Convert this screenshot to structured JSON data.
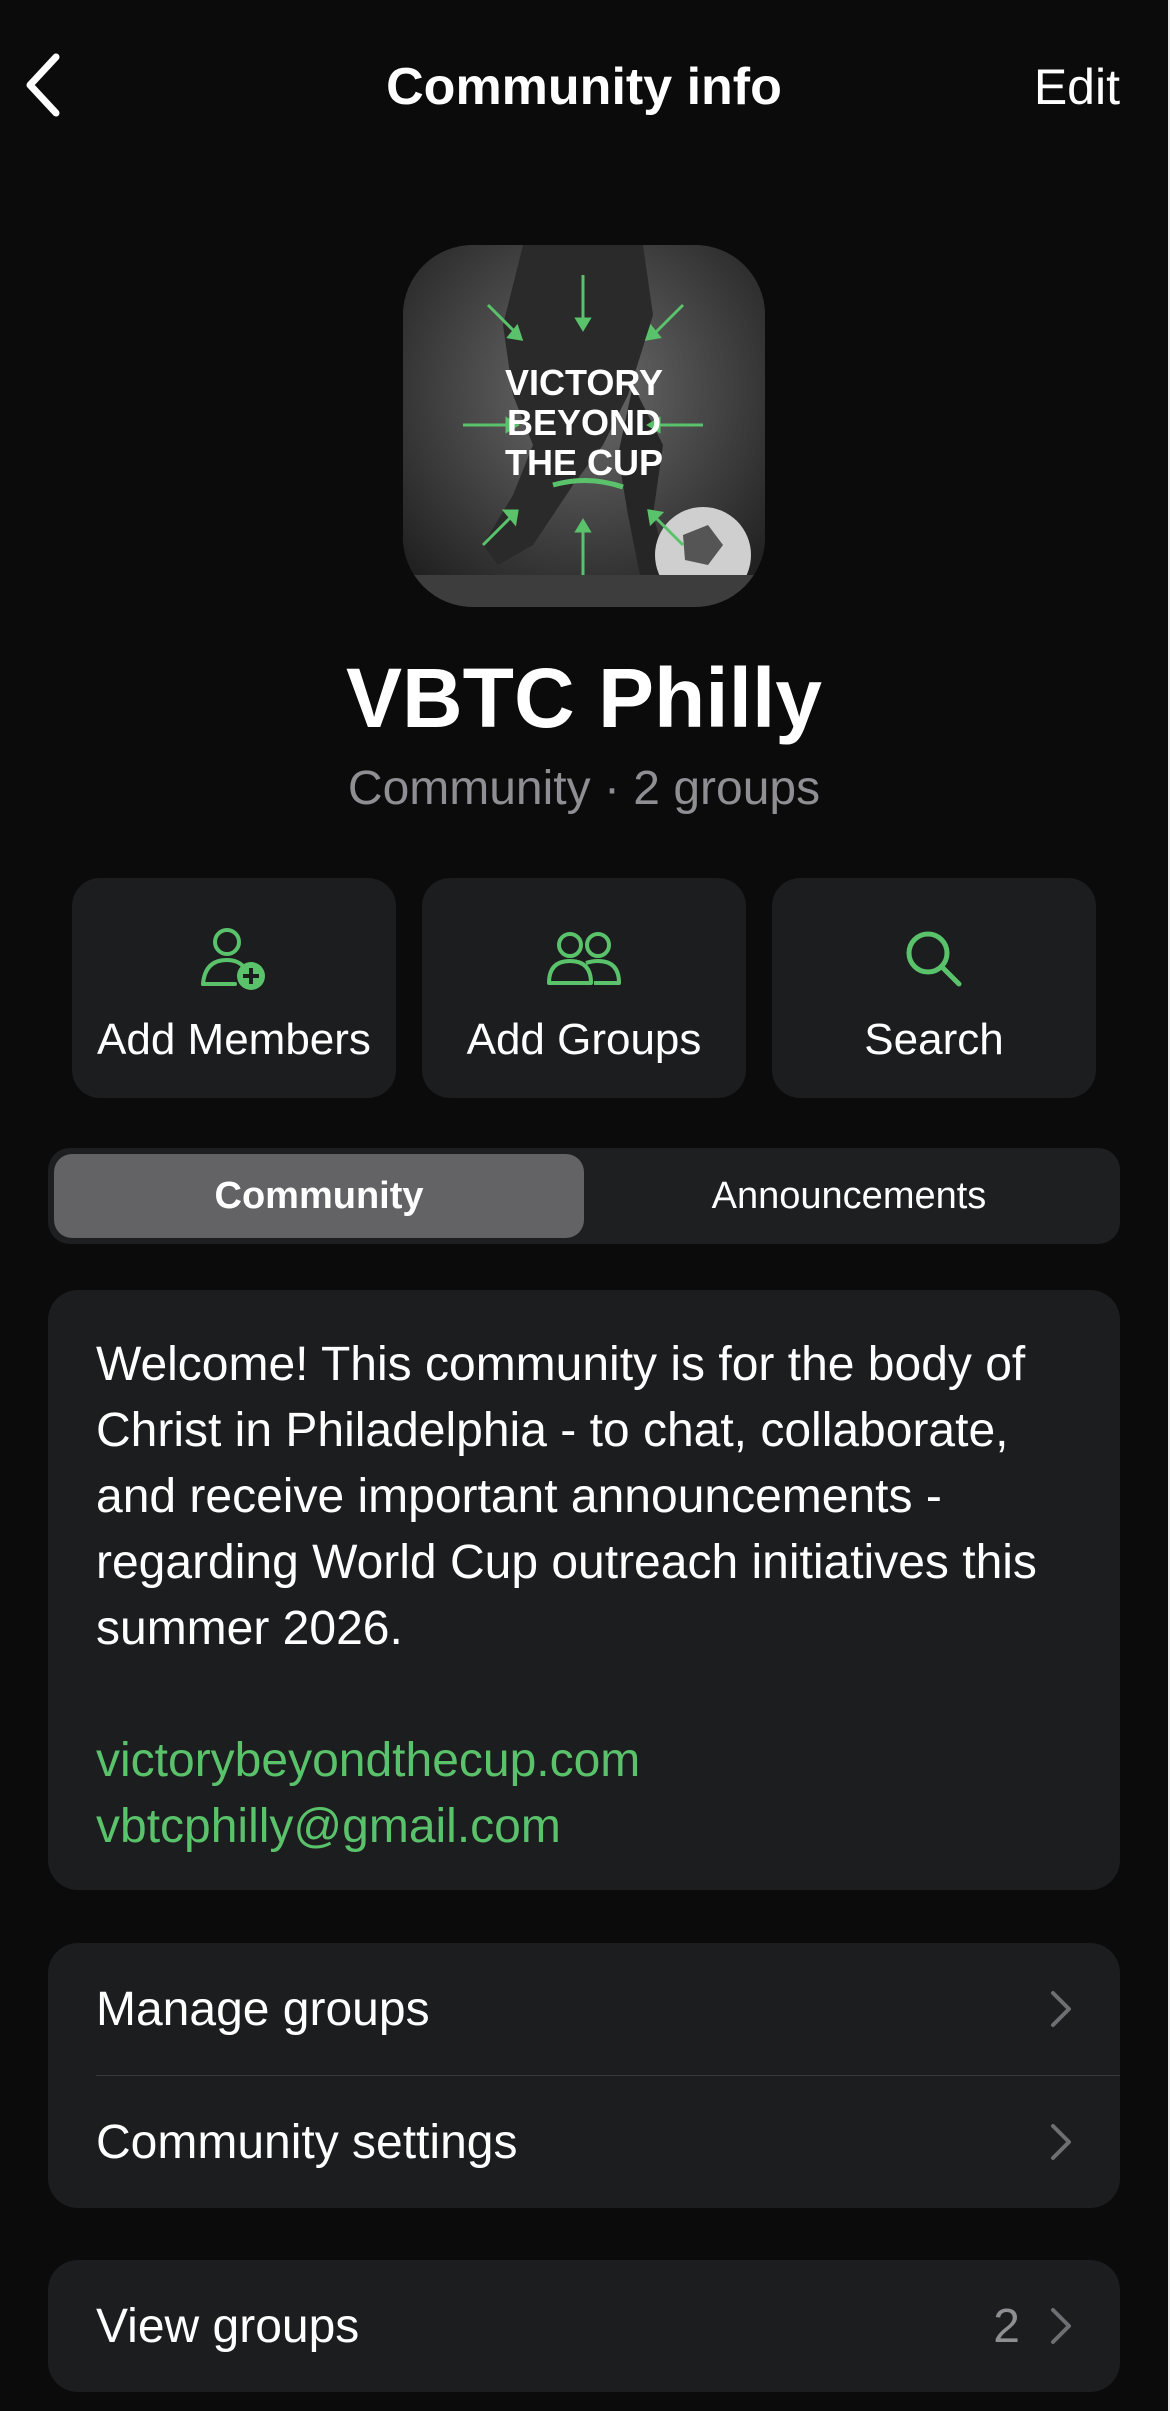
{
  "header": {
    "back_icon": "chevron-left-icon",
    "title": "Community info",
    "edit_label": "Edit"
  },
  "community": {
    "avatar_text": [
      "VICTORY",
      "BEYOND",
      "THE CUP"
    ],
    "name": "VBTC Philly",
    "subtitle": "Community · 2 groups"
  },
  "actions": [
    {
      "label": "Add Members",
      "icon": "person-add-icon"
    },
    {
      "label": "Add Groups",
      "icon": "people-icon"
    },
    {
      "label": "Search",
      "icon": "search-icon"
    }
  ],
  "tabs": [
    {
      "label": "Community",
      "selected": true
    },
    {
      "label": "Announcements",
      "selected": false
    }
  ],
  "description": {
    "text": "Welcome! This community is for the body of Christ in Philadelphia - to chat, collaborate, and receive important announcements - regarding World Cup outreach initiatives this summer 2026.",
    "website": "victorybeyondthecup.com",
    "email": "vbtcphilly@gmail.com"
  },
  "settings": {
    "items": [
      {
        "label": "Manage groups"
      },
      {
        "label": "Community settings"
      }
    ]
  },
  "groups": {
    "label": "View groups",
    "count": "2"
  },
  "colors": {
    "background": "#0b0b0b",
    "card": "#1c1d1e",
    "accent_green": "#5ac26b",
    "secondary_text": "#8e8e93"
  }
}
